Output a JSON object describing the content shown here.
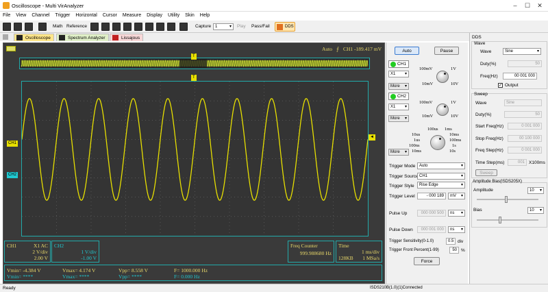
{
  "window": {
    "title": "Oscilloscope - Multi VirAnalyzer"
  },
  "menu": [
    "File",
    "View",
    "Channel",
    "Trigger",
    "Horizontal",
    "Cursor",
    "Measure",
    "Display",
    "Utility",
    "Skin",
    "Help"
  ],
  "toolbar": {
    "math": "Math",
    "reference": "Reference",
    "capture": "Capture",
    "capture_count": "1",
    "play": "Play",
    "pass_fail": "Pass/Fail",
    "dds": "DDS"
  },
  "tabs": [
    "Oscilloscope",
    "Spectrum Analyzer",
    "Lissajous"
  ],
  "scope": {
    "status": "Auto",
    "trigger_readout": "CH1 -189.417 mV",
    "trigger_marker": "T",
    "ch1_marker": "CH1",
    "ch2_marker": "CH2",
    "right_marker": "◄"
  },
  "info": {
    "ch1": {
      "name": "CH1",
      "coupling": "X1  AC",
      "vdiv": "2 V/div",
      "offset": "2.00 V"
    },
    "ch2": {
      "name": "CH2",
      "vdiv": "1 V/div",
      "offset": "-1.00 V"
    },
    "freq": {
      "label": "Freq Counter",
      "value": "999.988680 Hz"
    },
    "time": {
      "label": "Time",
      "div": "1 ms/div",
      "depth": "128KB",
      "rate": "1 MSa/s"
    },
    "measure": {
      "vmin1": "Vmin= -4.384 V",
      "vmax1": "Vmax= 4.174 V",
      "vpp1": "Vpp= 8.558 V",
      "f1": "F= 1000.000 Hz",
      "vmin2": "Vmin= ****",
      "vmax2": "Vmax= ****",
      "vpp2": "Vpp= ****",
      "f2": "F= 0.000 Hz"
    }
  },
  "controls": {
    "auto": "Auto",
    "pause": "Pause",
    "ch1_label": "CH1",
    "ch1_probe": "X1",
    "ch1_more": "More",
    "ch1_knob": {
      "top_left": "100mV",
      "top_right": "1V",
      "bot_left": "10mV",
      "bot_right": "10V"
    },
    "ch2_label": "CH2",
    "ch2_probe": "X1",
    "ch2_more": "More",
    "ch2_knob": {
      "top_left": "100mV",
      "top_right": "1V",
      "bot_left": "10mV",
      "bot_right": "10V"
    },
    "time_knob": {
      "t1": "100us",
      "t2": "1ms",
      "l1": "10us",
      "r1": "10ms",
      "l2": "1us",
      "r2": "100ms",
      "l3": "100ns",
      "r3": "1s",
      "l4": "10ms",
      "r4": "10s"
    },
    "time_more": "More",
    "trigger_mode_label": "Trigger Mode",
    "trigger_mode": "Auto",
    "trigger_source_label": "Trigger Source",
    "trigger_source": "CH1",
    "trigger_style_label": "Trigger Style",
    "trigger_style": "Rise Edge",
    "trigger_level_label": "Trigger Level",
    "trigger_level": "- 000 189",
    "trigger_level_unit": "mV",
    "pulse_up_label": "Pulse Up",
    "pulse_up": "000 000 500",
    "pulse_up_unit": "ns",
    "pulse_down_label": "Pulse Down",
    "pulse_down": "000 001 000",
    "pulse_down_unit": "ns",
    "sensitivity_label": "Trigger Sensitivity(0-1.0)",
    "sensitivity": "0.5",
    "sensitivity_unit": "div",
    "front_label": "Trigger Front Percent(1-99)",
    "front": "50",
    "front_unit": "%",
    "force": "Force"
  },
  "dds": {
    "title": "DDS",
    "wave_group": "Wave",
    "wave_label": "Wave",
    "wave": "Sine",
    "duty_label": "Duty(%)",
    "duty": "50",
    "freq_label": "Freq(Hz)",
    "freq": "00 001 000",
    "output_label": "Output",
    "sweep_group": "Sweep",
    "s_wave_label": "Wave",
    "s_wave": "Sine",
    "s_duty_label": "Duty(%)",
    "s_duty": "50",
    "start_label": "Start Freq(Hz)",
    "start": "0 001 000",
    "stop_label": "Stop Freq(Hz)",
    "stop": "00 100 000",
    "step_label": "Freq Step(Hz)",
    "step": "0 001 000",
    "tstep_label": "Time Step(ms)",
    "tstep": "001",
    "tstep_unit": "X100ms",
    "sweep_btn": "Sweep",
    "bias_group": "Amplitude Bias(ISDS205X)",
    "amp_label": "Amplitude",
    "amp": "10",
    "bias_label": "Bias",
    "bias": "10"
  },
  "status": {
    "left": "Ready",
    "right": "ISDS210B(1.0)(1)Connected"
  },
  "colors": {
    "ch1": "#e8e000",
    "ch2": "#20c8d0",
    "frame": "#22a8a8",
    "readout": "#e8d86a"
  }
}
